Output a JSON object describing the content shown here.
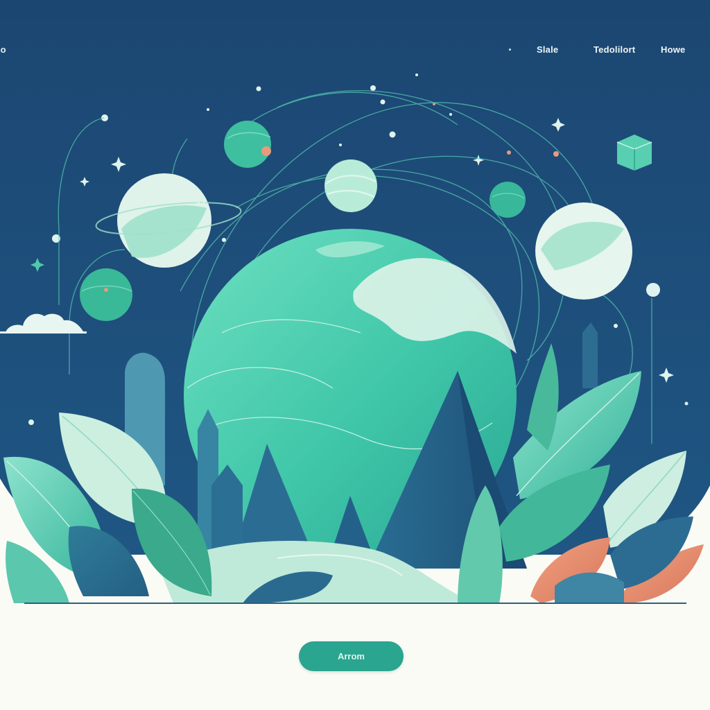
{
  "nav": {
    "logo_fragment": "jo",
    "links": [
      "Slale",
      "Tedolilort",
      "Howe"
    ]
  },
  "cta": {
    "label": "Arrom"
  },
  "colors": {
    "sky": "#1d4a72",
    "planet_teal": "#3cc4a5",
    "leaf_green": "#46c7a8",
    "leaf_coral": "#e88d6c",
    "mint_light": "#dff3ea",
    "cta": "#2aa58f",
    "page_background": "#fbfbf6"
  }
}
